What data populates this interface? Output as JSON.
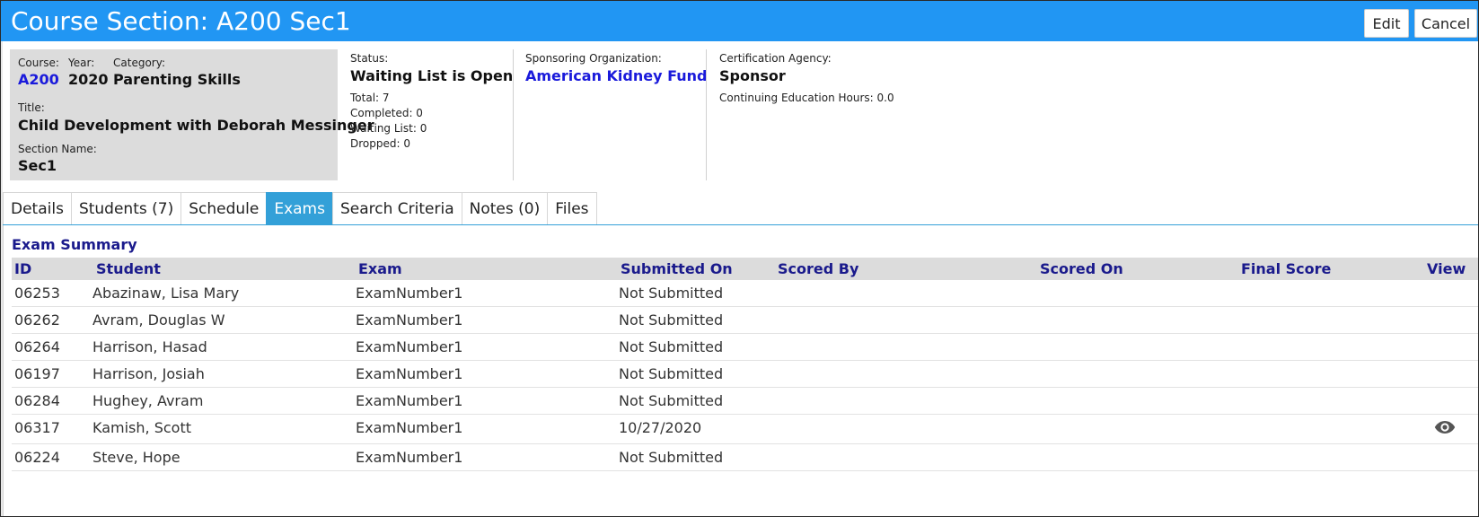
{
  "window": {
    "title": "Course Section: A200 Sec1",
    "edit_label": "Edit",
    "cancel_label": "Cancel",
    "accent_color": "#2196f3"
  },
  "course_info": {
    "course_label": "Course:",
    "course_value": "A200",
    "year_label": "Year:",
    "year_value": "2020",
    "category_label": "Category:",
    "category_value": "Parenting Skills",
    "title_label": "Title:",
    "title_value": "Child Development with Deborah Messinger",
    "section_label": "Section Name:",
    "section_value": "Sec1"
  },
  "status": {
    "label": "Status:",
    "value": "Waiting List is Open",
    "total": "Total: 7",
    "completed": "Completed: 0",
    "waiting": "Waiting List: 0",
    "dropped": "Dropped: 0"
  },
  "sponsor": {
    "label": "Sponsoring Organization:",
    "value": "American Kidney Fund"
  },
  "certification": {
    "label": "Certification Agency:",
    "value": "Sponsor",
    "hours": "Continuing Education Hours: 0.0"
  },
  "tabs": [
    {
      "label": "Details"
    },
    {
      "label": "Students (7)"
    },
    {
      "label": "Schedule"
    },
    {
      "label": "Exams",
      "active": true
    },
    {
      "label": "Search Criteria"
    },
    {
      "label": "Notes (0)"
    },
    {
      "label": "Files"
    }
  ],
  "exam_summary": {
    "title": "Exam Summary",
    "headers": [
      "ID",
      "Student",
      "Exam",
      "Submitted On",
      "Scored By",
      "Scored On",
      "Final Score",
      "View"
    ],
    "rows": [
      {
        "id": "06253",
        "student": "Abazinaw, Lisa Mary",
        "exam": "ExamNumber1",
        "submitted": "Not Submitted",
        "scored_by": "",
        "scored_on": "",
        "final_score": "",
        "view_icon": "none"
      },
      {
        "id": "06262",
        "student": "Avram, Douglas W",
        "exam": "ExamNumber1",
        "submitted": "Not Submitted",
        "scored_by": "",
        "scored_on": "",
        "final_score": "",
        "view_icon": "none"
      },
      {
        "id": "06264",
        "student": "Harrison, Hasad",
        "exam": "ExamNumber1",
        "submitted": "Not Submitted",
        "scored_by": "",
        "scored_on": "",
        "final_score": "",
        "view_icon": "none"
      },
      {
        "id": "06197",
        "student": "Harrison, Josiah",
        "exam": "ExamNumber1",
        "submitted": "Not Submitted",
        "scored_by": "",
        "scored_on": "",
        "final_score": "",
        "view_icon": "none"
      },
      {
        "id": "06284",
        "student": "Hughey, Avram",
        "exam": "ExamNumber1",
        "submitted": "Not Submitted",
        "scored_by": "",
        "scored_on": "",
        "final_score": "",
        "view_icon": "none"
      },
      {
        "id": "06317",
        "student": "Kamish, Scott",
        "exam": "ExamNumber1",
        "submitted": "10/27/2020",
        "scored_by": "",
        "scored_on": "",
        "final_score": "",
        "view_icon": "eye-icon"
      },
      {
        "id": "06224",
        "student": "Steve, Hope",
        "exam": "ExamNumber1",
        "submitted": "Not Submitted",
        "scored_by": "",
        "scored_on": "",
        "final_score": "",
        "view_icon": "none"
      }
    ]
  }
}
